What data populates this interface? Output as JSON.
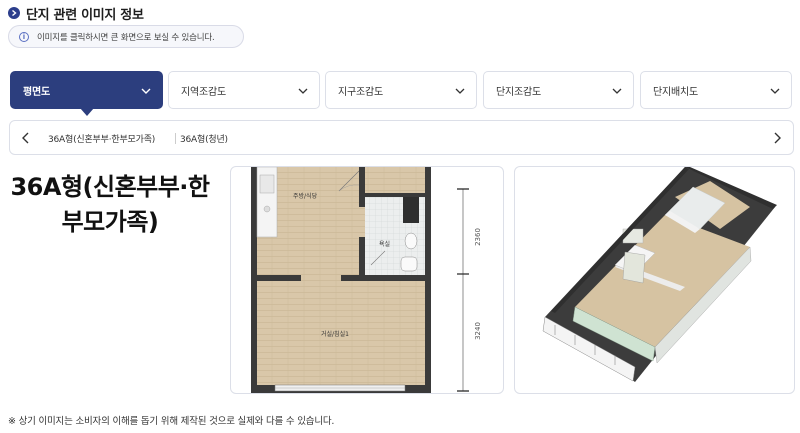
{
  "header": {
    "title": "단지 관련 이미지 정보",
    "notice_icon": "info-icon",
    "notice": "이미지를 클릭하시면 큰 화면으로 보실 수 있습니다."
  },
  "tabs": [
    {
      "label": "평면도",
      "active": true
    },
    {
      "label": "지역조감도",
      "active": false
    },
    {
      "label": "지구조감도",
      "active": false
    },
    {
      "label": "단지조감도",
      "active": false
    },
    {
      "label": "단지배치도",
      "active": false
    }
  ],
  "unit_types": {
    "items": [
      "36A형(신혼부부·한부모가족)",
      "36A형(청년)"
    ]
  },
  "unit_title": "36A형(신혼부부·한부모가족)",
  "floor_plan": {
    "rooms": {
      "kitchen": "주방/식당",
      "bath": "욕실",
      "living": "거실/침실1"
    },
    "dimensions": [
      "2360",
      "3240"
    ]
  },
  "footnote": "※ 상기 이미지는 소비자의 이해를 돕기 위해 제작된 것으로 실제와 다를 수 있습니다.",
  "colors": {
    "accent": "#2c3e7e",
    "border": "#dcdfe8",
    "floor_wood": "#d8c6a8"
  }
}
